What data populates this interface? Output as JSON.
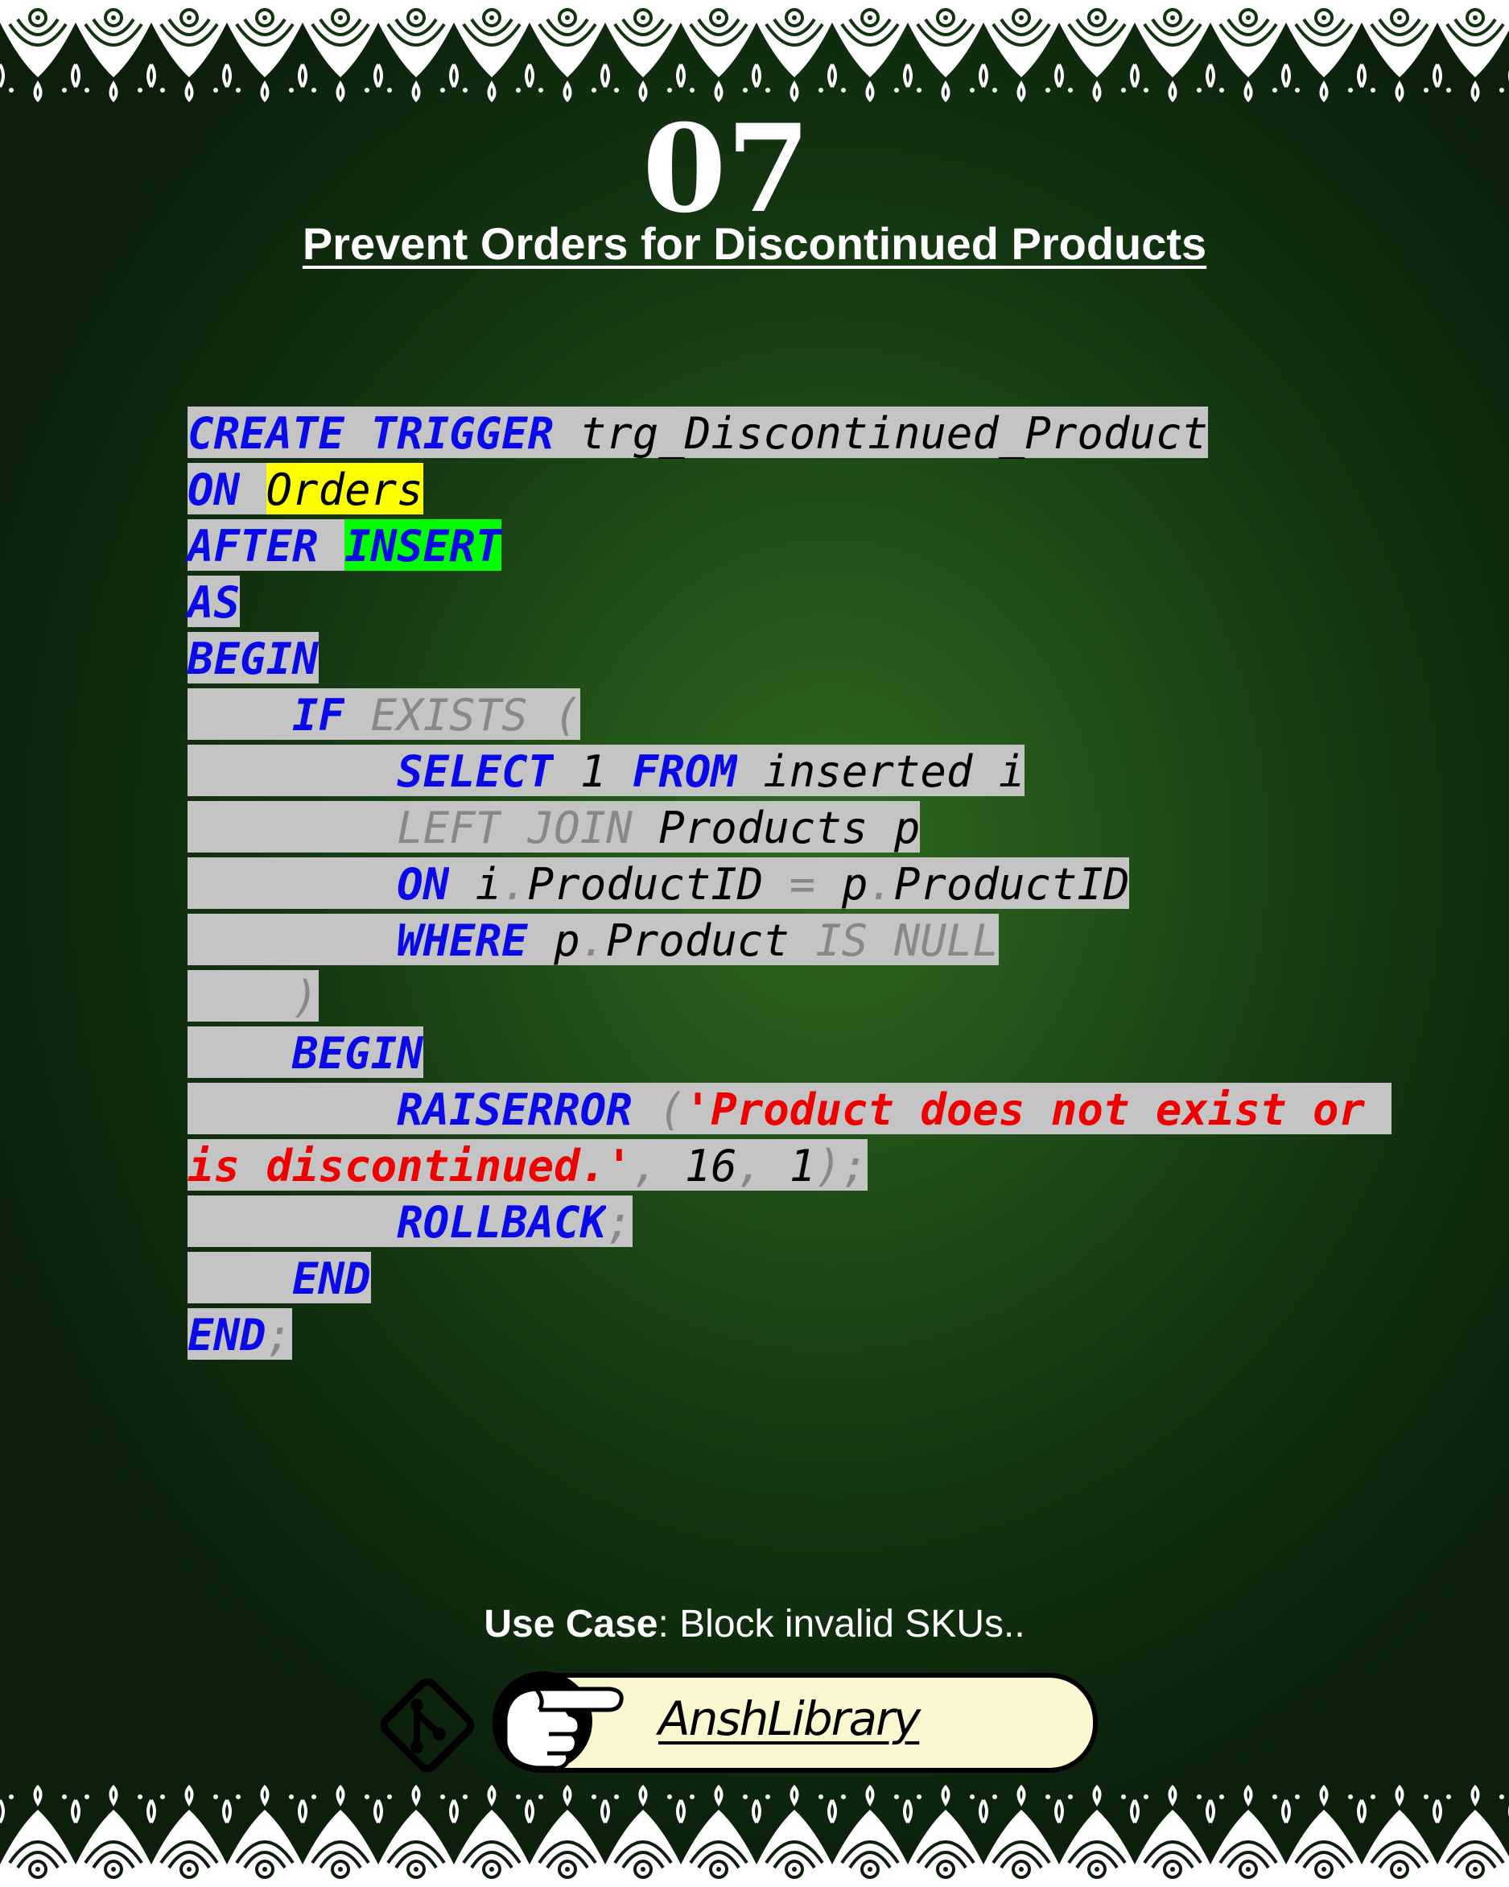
{
  "slide": {
    "number": "07",
    "title": "Prevent Orders for Discontinued Products"
  },
  "code_lines": [
    [
      [
        "kw",
        "CREATE"
      ],
      [
        "sp",
        " "
      ],
      [
        "kw",
        "TRIGGER"
      ],
      [
        "sp",
        " "
      ],
      [
        "id",
        "trg_Discontinued_Product"
      ]
    ],
    [
      [
        "kw",
        "ON"
      ],
      [
        "sp",
        " "
      ],
      [
        "idy",
        "Orders"
      ]
    ],
    [
      [
        "kw",
        "AFTER"
      ],
      [
        "sp",
        " "
      ],
      [
        "kwg",
        "INSERT"
      ]
    ],
    [
      [
        "kw",
        "AS"
      ]
    ],
    [
      [
        "kw",
        "BEGIN"
      ]
    ],
    [
      [
        "sp",
        "    "
      ],
      [
        "kw",
        "IF"
      ],
      [
        "sp",
        " "
      ],
      [
        "gr",
        "EXISTS"
      ],
      [
        "sp",
        " "
      ],
      [
        "gr",
        "("
      ]
    ],
    [
      [
        "sp",
        "        "
      ],
      [
        "kw",
        "SELECT"
      ],
      [
        "sp",
        " "
      ],
      [
        "id",
        "1"
      ],
      [
        "sp",
        " "
      ],
      [
        "kw",
        "FROM"
      ],
      [
        "sp",
        " "
      ],
      [
        "id",
        "inserted i"
      ]
    ],
    [
      [
        "sp",
        "        "
      ],
      [
        "gr",
        "LEFT"
      ],
      [
        "sp",
        " "
      ],
      [
        "gr",
        "JOIN"
      ],
      [
        "sp",
        " "
      ],
      [
        "id",
        "Products p"
      ]
    ],
    [
      [
        "sp",
        "        "
      ],
      [
        "kw",
        "ON"
      ],
      [
        "sp",
        " "
      ],
      [
        "id",
        "i"
      ],
      [
        "gr",
        "."
      ],
      [
        "id",
        "ProductID"
      ],
      [
        "sp",
        " "
      ],
      [
        "gr",
        "="
      ],
      [
        "sp",
        " "
      ],
      [
        "id",
        "p"
      ],
      [
        "gr",
        "."
      ],
      [
        "id",
        "ProductID"
      ]
    ],
    [
      [
        "sp",
        "        "
      ],
      [
        "kw",
        "WHERE"
      ],
      [
        "sp",
        " "
      ],
      [
        "id",
        "p"
      ],
      [
        "gr",
        "."
      ],
      [
        "id",
        "Product"
      ],
      [
        "sp",
        " "
      ],
      [
        "gr",
        "IS"
      ],
      [
        "sp",
        " "
      ],
      [
        "gr",
        "NULL"
      ]
    ],
    [
      [
        "sp",
        "    "
      ],
      [
        "gr",
        ")"
      ]
    ],
    [
      [
        "sp",
        "    "
      ],
      [
        "kw",
        "BEGIN"
      ]
    ],
    [
      [
        "sp",
        "        "
      ],
      [
        "kw",
        "RAISERROR"
      ],
      [
        "sp",
        " "
      ],
      [
        "gr",
        "("
      ],
      [
        "str",
        "'Product does not exist or "
      ]
    ],
    [
      [
        "str",
        "is discontinued.'"
      ],
      [
        "gr",
        ","
      ],
      [
        "sp",
        " "
      ],
      [
        "id",
        "16"
      ],
      [
        "gr",
        ","
      ],
      [
        "sp",
        " "
      ],
      [
        "id",
        "1"
      ],
      [
        "gr",
        ");"
      ]
    ],
    [
      [
        "sp",
        "        "
      ],
      [
        "kw",
        "ROLLBACK"
      ],
      [
        "gr",
        ";"
      ]
    ],
    [
      [
        "sp",
        "    "
      ],
      [
        "kw",
        "END"
      ]
    ],
    [
      [
        "kw",
        "END"
      ],
      [
        "gr",
        ";"
      ]
    ]
  ],
  "use_case": {
    "label": "Use Case",
    "text": ": Block invalid SKUs.."
  },
  "brand": {
    "name": "AnshLibrary",
    "icons": [
      "git-icon",
      "pointing-hand-icon"
    ]
  },
  "colors": {
    "keyword": "#0a0ae8",
    "string": "#ee0000",
    "muted": "#888888",
    "code_background": "#c4c4c4",
    "highlight_yellow": "#ffff00",
    "highlight_green": "#00ff00",
    "pill": "#faf6d0"
  }
}
